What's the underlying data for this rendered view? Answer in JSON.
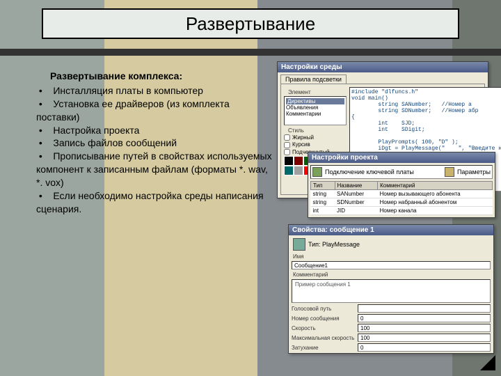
{
  "slide": {
    "title": "Развертывание",
    "heading": "Развертывание комплекса:",
    "bullets": [
      "Инсталляция платы в компьютер",
      "Установка ее драйверов (из комплекта поставки)",
      "Настройка проекта",
      "Запись файлов сообщений",
      "Прописывание путей в свойствах используемых компонент к записанным файлам (форматы *. wav, *. vox)",
      "Если необходимо настройка среды написания сценария."
    ]
  },
  "win1": {
    "title": "Настройки среды",
    "tab": "Правила подсветки",
    "group_label": "Элемент",
    "list_items": [
      "Директивы",
      "Объявления",
      "Комментарии"
    ],
    "style_label": "Стиль",
    "checks": [
      "Жирный",
      "Курсив",
      "Подчеркнутый"
    ],
    "code_lines": [
      "#include \"dlfuncs.h\"",
      "void main()",
      "        string SANumber;   //Номер а",
      "        string SDNumber;   //Номер абр",
      "{",
      "        int    SJD;",
      "        int    SDigit;",
      "",
      "        PlayPrompts( 100, \"D\" );",
      "        iDgt = PlayMessage(\"    \", \"Введите но"
    ],
    "swatches": [
      "#000000",
      "#7a0000",
      "#006000",
      "#6a6a00",
      "#000080",
      "#600060",
      "#006a6a",
      "#a0a0a0",
      "#ff0000",
      "#00c000",
      "#b0b000",
      "#3030ff"
    ]
  },
  "win2": {
    "title": "Настройки проекта",
    "breadcrumb": "Подключение ключевой платы",
    "btn": "Параметры",
    "columns": [
      "Тип",
      "Название",
      "Комментарий"
    ],
    "rows": [
      [
        "string",
        "SANumber",
        "Номер вызывающего абонента"
      ],
      [
        "string",
        "SDNumber",
        "Номер набранный абонентом"
      ],
      [
        "int",
        "JID",
        "Номер канала"
      ]
    ]
  },
  "win3": {
    "title": "Свойства: сообщение 1",
    "type_label": "Тип: PlayMessage",
    "name_label": "Имя",
    "name_value": "Сообщение1",
    "comment_label": "Комментарий",
    "body_value": "Пример сообщения 1",
    "fields": [
      {
        "label": "Голосовой путь",
        "value": ""
      },
      {
        "label": "Номер сообщения",
        "value": "0"
      },
      {
        "label": "Скорость",
        "value": "100"
      },
      {
        "label": "Максимальная скорость",
        "value": "100"
      },
      {
        "label": "Затухание",
        "value": "0"
      }
    ]
  }
}
